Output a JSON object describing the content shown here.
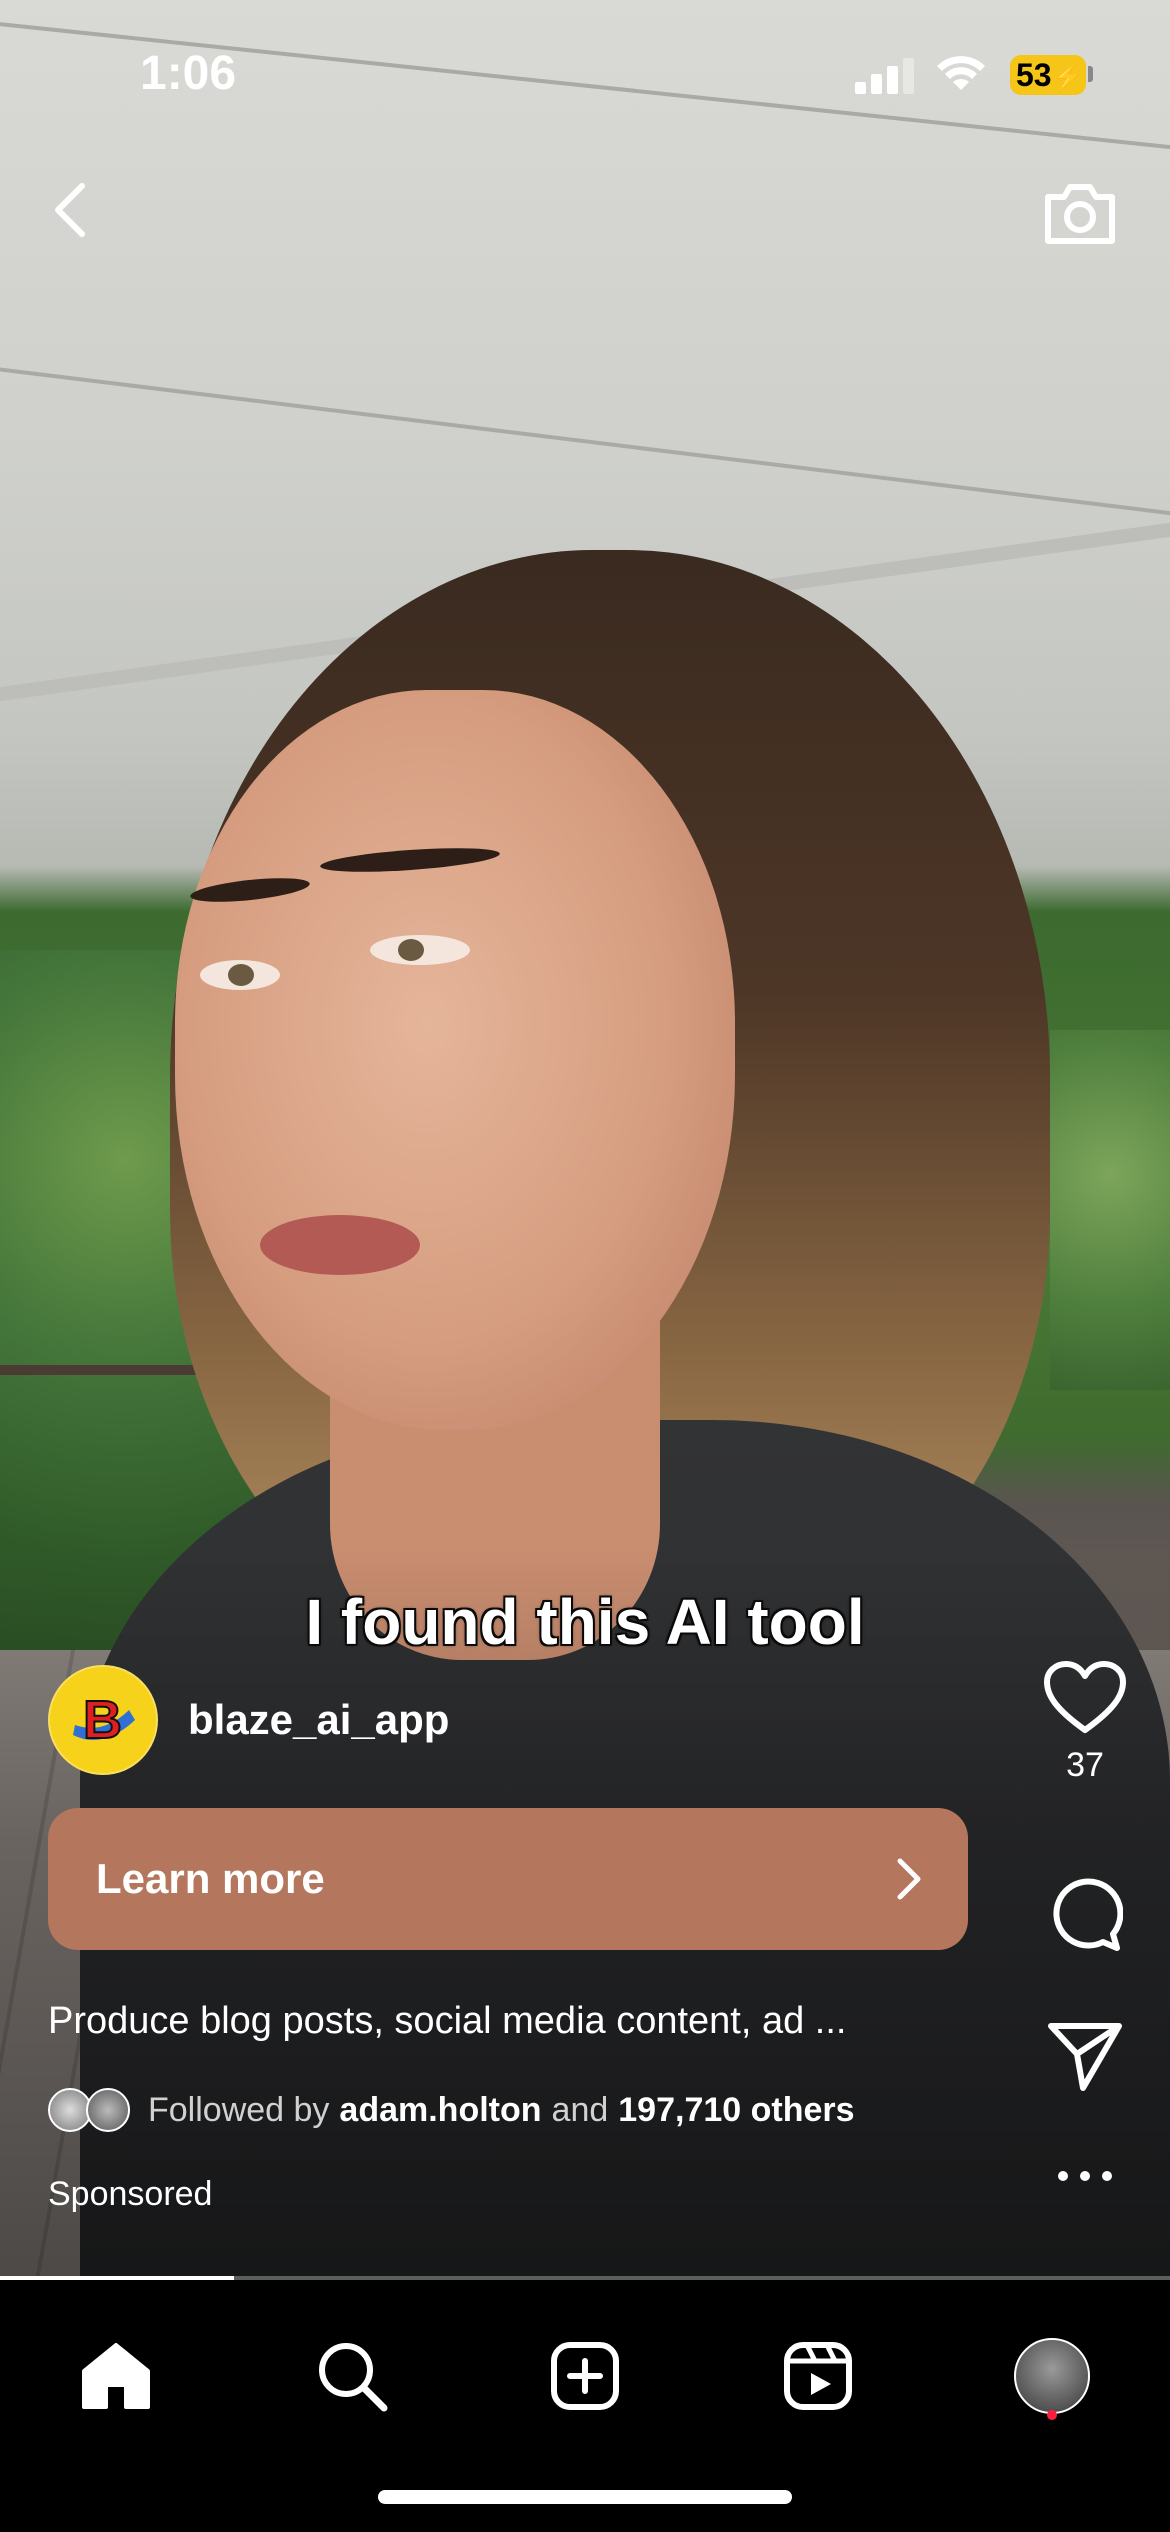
{
  "status_bar": {
    "time": "1:06",
    "battery": "53"
  },
  "reel": {
    "caption": "I found this AI tool",
    "account": {
      "username": "blaze_ai_app",
      "avatar_letter": "B"
    },
    "cta": {
      "label": "Learn more"
    },
    "description": "Produce blog posts, social media content, ad ...",
    "followed": {
      "prefix": "Followed by",
      "user": "adam.holton",
      "conjunction": "and",
      "others": "197,710 others"
    },
    "sponsored": "Sponsored",
    "likes": "37",
    "progress": 0.2
  },
  "icons": {
    "top": [
      "back-icon",
      "camera-icon"
    ],
    "actions": [
      "heart-icon",
      "comment-icon",
      "share-icon",
      "more-icon"
    ],
    "tabs": [
      "home-icon",
      "search-icon",
      "create-icon",
      "reels-icon",
      "profile-avatar"
    ]
  },
  "colors": {
    "cta": "#b4765d",
    "brand_avatar": "#f6d21a",
    "notification": "#ff1f3d"
  }
}
